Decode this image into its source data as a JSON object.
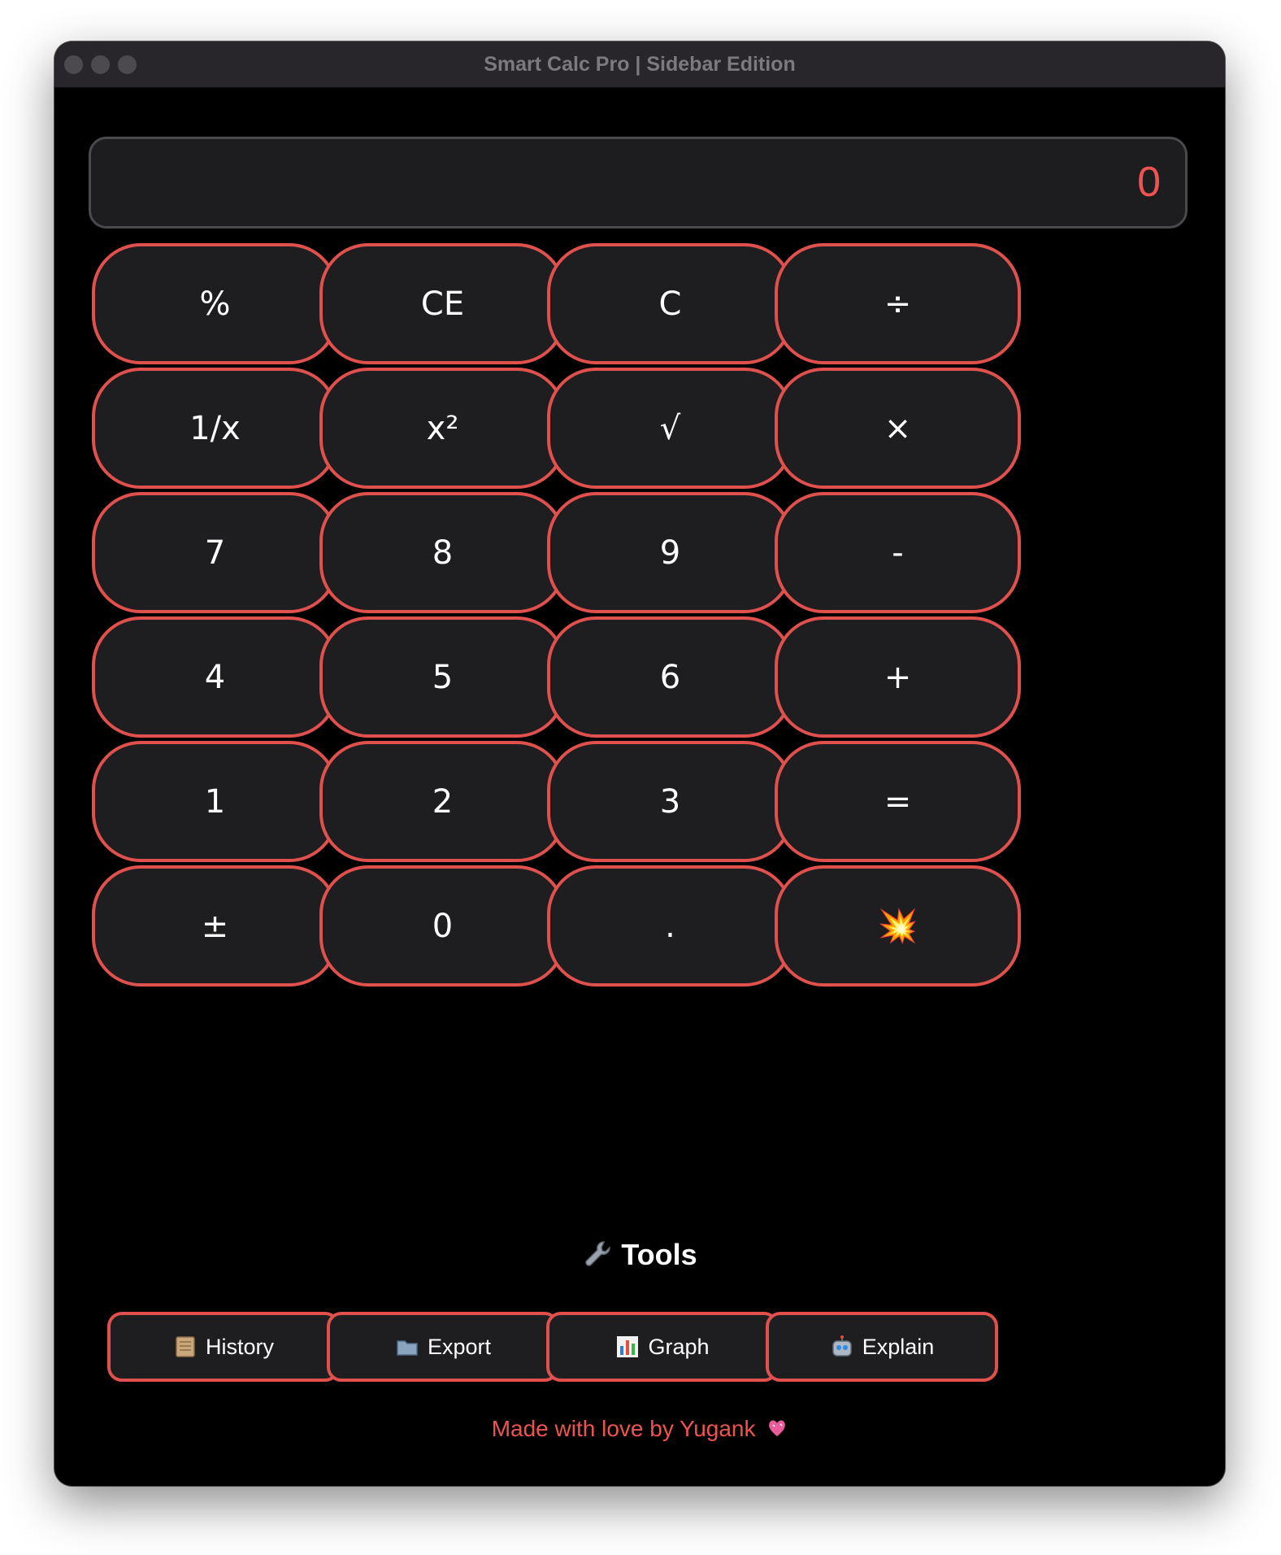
{
  "window": {
    "title": "Smart Calc Pro | Sidebar Edition"
  },
  "display": {
    "value": "0"
  },
  "keypad": {
    "rows": [
      [
        "%",
        "CE",
        "C",
        "÷"
      ],
      [
        "1/x",
        "x²",
        "√",
        "×"
      ],
      [
        "7",
        "8",
        "9",
        "-"
      ],
      [
        "4",
        "5",
        "6",
        "+"
      ],
      [
        "1",
        "2",
        "3",
        "="
      ],
      [
        "±",
        "0",
        ".",
        "💥"
      ]
    ]
  },
  "tools": {
    "heading": "Tools",
    "heading_icon": "wrench-icon",
    "buttons": [
      {
        "label": "History",
        "icon": "scroll-icon"
      },
      {
        "label": "Export",
        "icon": "folder-icon"
      },
      {
        "label": "Graph",
        "icon": "bar-chart-icon"
      },
      {
        "label": "Explain",
        "icon": "robot-icon"
      }
    ]
  },
  "footer": {
    "text": "Made with love by Yugank",
    "icon": "heart-icon"
  },
  "colors": {
    "accent": "#e0514d",
    "display_text": "#ef5350",
    "background": "#000000",
    "key_fill": "#1e1d1f"
  }
}
